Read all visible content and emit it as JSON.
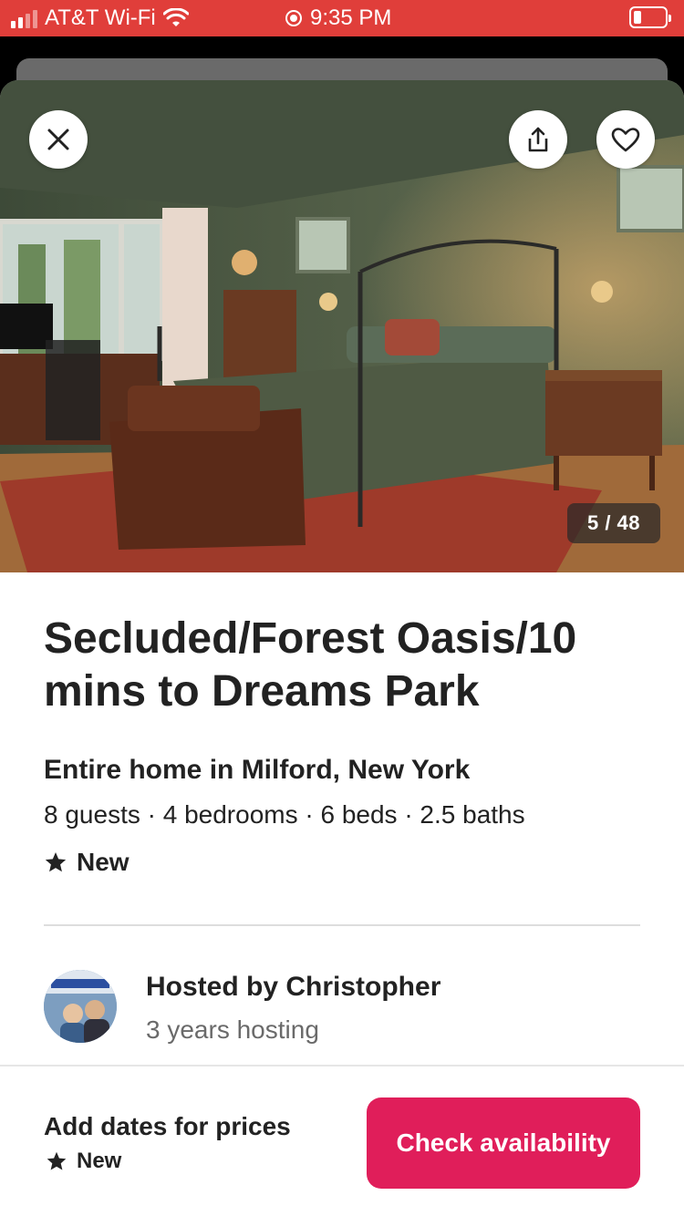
{
  "status_bar": {
    "carrier": "AT&T Wi-Fi",
    "time": "9:35 PM",
    "icons": [
      "signal-icon",
      "wifi-icon",
      "location-icon",
      "battery-icon"
    ]
  },
  "photo": {
    "counter": "5 / 48",
    "buttons": [
      "close-icon",
      "share-icon",
      "heart-icon"
    ]
  },
  "listing": {
    "title": "Secluded/Forest Oasis/10 mins to Dreams Park",
    "subtitle": "Entire home in Milford, New York",
    "specs": "8 guests · 4 bedrooms · 6 beds · 2.5 baths",
    "rating_label": "New"
  },
  "host": {
    "name": "Hosted by Christopher",
    "years": "3 years hosting"
  },
  "footer": {
    "price_text": "Add dates for prices",
    "rating_label": "New",
    "cta_label": "Check availability"
  },
  "colors": {
    "status_bar": "#e03e3a",
    "cta": "#e01e5a",
    "text": "#222222",
    "muted": "#6a6a6a"
  }
}
